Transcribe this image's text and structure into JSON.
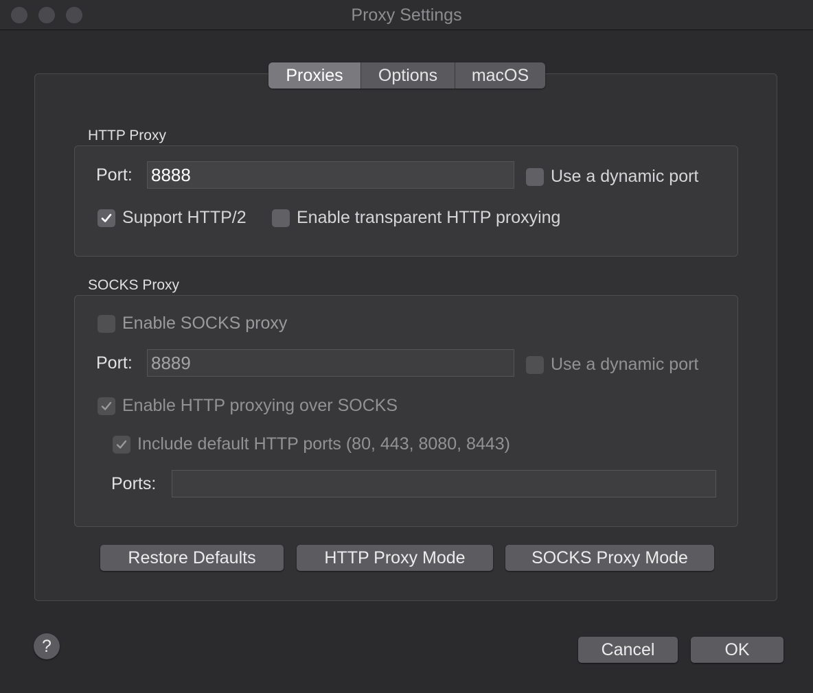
{
  "window": {
    "title": "Proxy Settings"
  },
  "tabs": [
    {
      "label": "Proxies",
      "active": true
    },
    {
      "label": "Options",
      "active": false
    },
    {
      "label": "macOS",
      "active": false
    }
  ],
  "http_proxy": {
    "group_label": "HTTP Proxy",
    "port_label": "Port:",
    "port_value": "8888",
    "dynamic_port_label": "Use a dynamic port",
    "dynamic_port_checked": false,
    "http2_label": "Support HTTP/2",
    "http2_checked": true,
    "transparent_label": "Enable transparent HTTP proxying",
    "transparent_checked": false
  },
  "socks_proxy": {
    "group_label": "SOCKS Proxy",
    "enable_label": "Enable SOCKS proxy",
    "enable_checked": false,
    "port_label": "Port:",
    "port_value": "8889",
    "dynamic_port_label": "Use a dynamic port",
    "dynamic_port_checked": false,
    "http_over_socks_label": "Enable HTTP proxying over SOCKS",
    "http_over_socks_checked": true,
    "include_default_label": "Include default HTTP ports (80, 443, 8080, 8443)",
    "include_default_checked": true,
    "ports_label": "Ports:",
    "ports_value": ""
  },
  "actions": {
    "restore_defaults": "Restore Defaults",
    "http_proxy_mode": "HTTP Proxy Mode",
    "socks_proxy_mode": "SOCKS Proxy Mode"
  },
  "footer": {
    "help": "?",
    "cancel": "Cancel",
    "ok": "OK"
  },
  "icons": {
    "close": "window-close-icon",
    "minimize": "window-minimize-icon",
    "zoom": "window-zoom-icon",
    "check": "checkmark-icon"
  }
}
